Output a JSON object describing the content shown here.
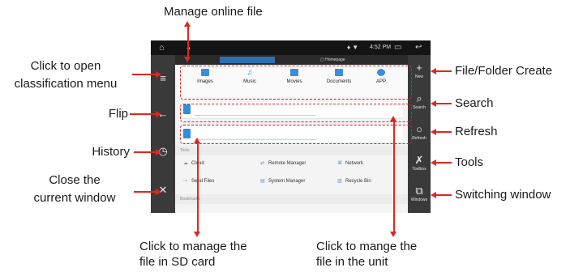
{
  "annotations": {
    "manage_online": "Manage online file",
    "classification_line1": "Click to open",
    "classification_line2": "classification menu",
    "flip": "Flip",
    "history": "History",
    "close_line1": "Close the",
    "close_line2": "current window",
    "file_folder_create": "File/Folder  Create",
    "search": "Search",
    "refresh": "Refresh",
    "tools": "Tools",
    "switching_window": "Switching window",
    "sd_line1": "Click to manage the",
    "sd_line2": "file in SD card",
    "unit_line1": "Click to mange the",
    "unit_line2": "file in the unit"
  },
  "statusbar": {
    "time": "4:52 PM"
  },
  "tabs": {
    "active": "",
    "inactive": "Homepage"
  },
  "categories": [
    {
      "label": "Images",
      "count": ""
    },
    {
      "label": "Music",
      "count": ""
    },
    {
      "label": "Movies",
      "count": ""
    },
    {
      "label": "Documents",
      "count": ""
    },
    {
      "label": "APP",
      "count": ""
    }
  ],
  "sidebar_right": {
    "new": "New",
    "search": "Search",
    "refresh": "Refresh",
    "toolbox": "Toolbox",
    "windows": "Windows"
  },
  "sections": {
    "tools": "Tools",
    "bookmarks": "Bookmarks"
  },
  "tools": {
    "cloud": "Cloud",
    "remote_manager": "Remote Manager",
    "network": "Network",
    "send_files": "Send Files",
    "system_manager": "System Manager",
    "recycle_bin": "Recycle Bin"
  },
  "colors": {
    "annotation": "#e0271f",
    "accent": "#2f6fb0",
    "sidebar": "#3a3a3a"
  }
}
